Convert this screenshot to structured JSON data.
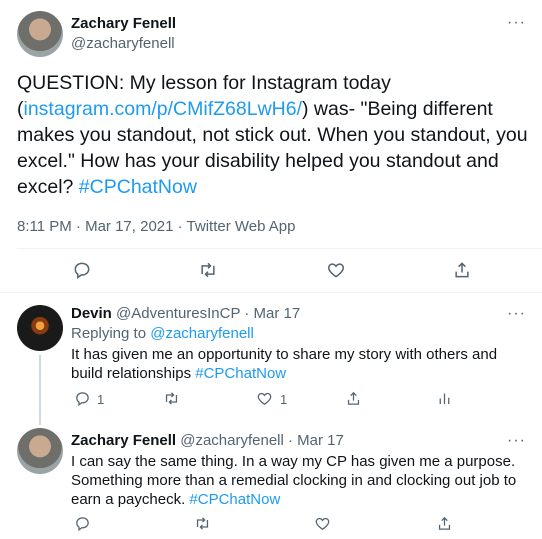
{
  "main_tweet": {
    "name": "Zachary Fenell",
    "handle": "@zacharyfenell",
    "text_before_link": "QUESTION: My lesson for Instagram today (",
    "link": "instagram.com/p/CMifZ68LwH6/",
    "text_after_link": ") was- \"Being different makes you standout, not stick out. When you standout, you excel.\" How has your disability helped you standout and excel? ",
    "hashtag": "#CPChatNow",
    "meta": "8:11 PM · Mar 17, 2021 · Twitter Web App",
    "more": "···"
  },
  "reply1": {
    "name": "Devin",
    "handle": "@AdventuresInCP",
    "date": "· Mar 17",
    "replying_to_prefix": "Replying to ",
    "replying_to_handle": "@zacharyfenell",
    "text": "It has given me an opportunity to share my story with others and build relationships ",
    "hashtag": "#CPChatNow",
    "reply_count": "1",
    "like_count": "1",
    "more": "···"
  },
  "reply2": {
    "name": "Zachary Fenell",
    "handle": "@zacharyfenell",
    "date": "· Mar 17",
    "text": "I can say the same thing. In a way my CP has given me a purpose. Something more than a remedial clocking in and clocking out job to earn a paycheck. ",
    "hashtag": "#CPChatNow",
    "more": "···"
  },
  "colors": {
    "link": "#1d9bf0",
    "muted": "#536471",
    "text": "#0f1419",
    "divider": "#eff3f4"
  }
}
